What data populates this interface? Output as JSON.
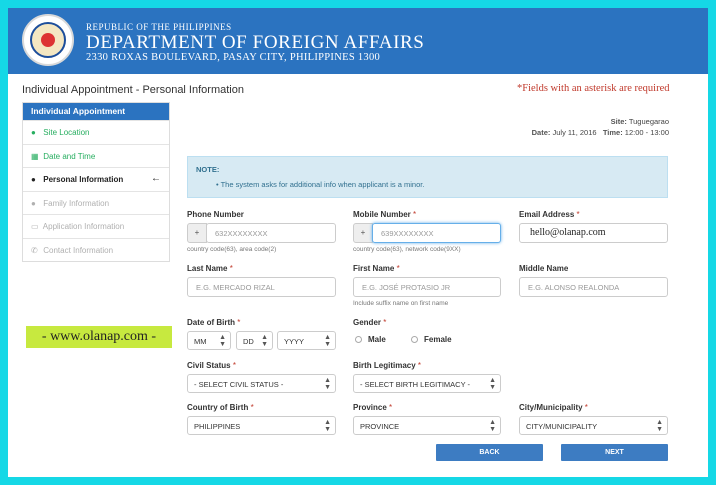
{
  "header": {
    "republic": "REPUBLIC OF THE PHILIPPINES",
    "department": "DEPARTMENT OF FOREIGN AFFAIRS",
    "address": "2330 ROXAS BOULEVARD, PASAY CITY, PHILIPPINES 1300"
  },
  "page": {
    "title": "Individual Appointment - Personal Information",
    "required_note": "*Fields with an asterisk are required"
  },
  "sidebar": {
    "heading": "Individual Appointment",
    "items": [
      {
        "label": "Site Location",
        "state": "done",
        "icon": "marker-icon"
      },
      {
        "label": "Date and Time",
        "state": "done",
        "icon": "calendar-icon"
      },
      {
        "label": "Personal Information",
        "state": "active",
        "icon": "user-icon"
      },
      {
        "label": "Family Information",
        "state": "disabled",
        "icon": "family-icon"
      },
      {
        "label": "Application Information",
        "state": "disabled",
        "icon": "document-icon"
      },
      {
        "label": "Contact Information",
        "state": "disabled",
        "icon": "phone-icon"
      }
    ]
  },
  "site_info": {
    "site_label": "Site:",
    "site_value": "Tuguegarao",
    "date_label": "Date:",
    "date_value": "July 11, 2016",
    "time_label": "Time:",
    "time_value": "12:00 - 13:00"
  },
  "note": {
    "title": "NOTE:",
    "body": "The system asks for additional info when applicant is a minor."
  },
  "form": {
    "phone": {
      "label": "Phone Number",
      "prefix": "+",
      "placeholder": "632XXXXXXXX",
      "help": "country code(63), area code(2)"
    },
    "mobile": {
      "label": "Mobile Number",
      "prefix": "+",
      "placeholder": "639XXXXXXXX",
      "help": "country code(63), network code(9XX)"
    },
    "email": {
      "label": "Email Address",
      "value": "hello@olanap.com"
    },
    "last_name": {
      "label": "Last Name",
      "placeholder": "E.G. MERCADO RIZAL"
    },
    "first_name": {
      "label": "First Name",
      "placeholder": "E.G. JOSÉ PROTASIO JR",
      "help": "Include suffix name on first name"
    },
    "middle_name": {
      "label": "Middle Name",
      "placeholder": "E.G. ALONSO REALONDA"
    },
    "dob": {
      "label": "Date of Birth",
      "month": "MM",
      "day": "DD",
      "year": "YYYY"
    },
    "gender": {
      "label": "Gender",
      "options": [
        "Male",
        "Female"
      ]
    },
    "civil_status": {
      "label": "Civil Status",
      "selected": "- SELECT CIVIL STATUS -"
    },
    "birth_legitimacy": {
      "label": "Birth Legitimacy",
      "selected": "- SELECT BIRTH LEGITIMACY -"
    },
    "country_of_birth": {
      "label": "Country of Birth",
      "selected": "PHILIPPINES"
    },
    "province": {
      "label": "Province",
      "selected": "PROVINCE"
    },
    "city": {
      "label": "City/Municipality",
      "selected": "CITY/MUNICIPALITY"
    },
    "required_mark": "*"
  },
  "buttons": {
    "back": "BACK",
    "next": "NEXT"
  },
  "watermark": "- www.olanap.com -",
  "colors": {
    "brand_blue": "#2b73c0",
    "required_red": "#c0392b",
    "done_green": "#27ae60",
    "frame_cyan": "#15d8e6"
  }
}
